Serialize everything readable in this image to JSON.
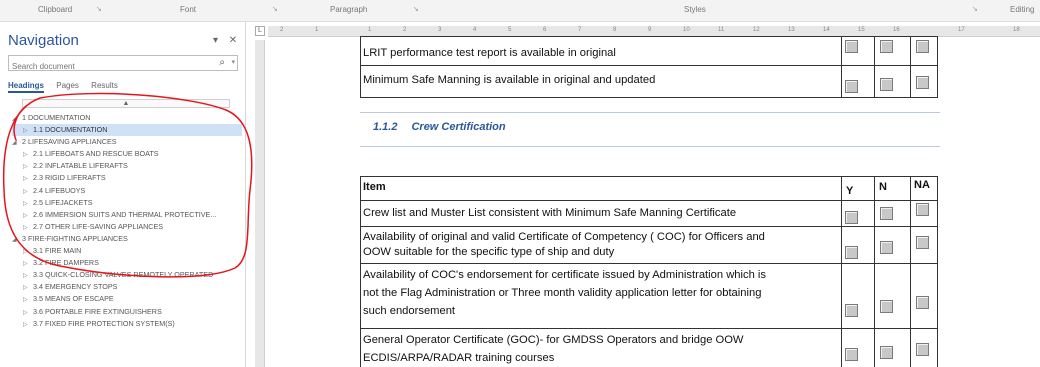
{
  "ribbon": {
    "groups": [
      "Clipboard",
      "Font",
      "Paragraph",
      "Styles",
      "Editing"
    ]
  },
  "nav": {
    "title": "Navigation",
    "title_controls": "▾ ✕",
    "search_placeholder": "Search document",
    "search_icon": "search-icon",
    "tabs": [
      "Headings",
      "Pages",
      "Results"
    ],
    "active_tab": "Headings",
    "collapse_glyph": "▲",
    "items": [
      {
        "level": 1,
        "label": "1 DOCUMENTATION",
        "expanded": true
      },
      {
        "level": 2,
        "label": "1.1 DOCUMENTATION",
        "selected": true
      },
      {
        "level": 1,
        "label": "2 LIFESAVING APPLIANCES",
        "expanded": true
      },
      {
        "level": 2,
        "label": "2.1 LIFEBOATS AND RESCUE BOATS"
      },
      {
        "level": 2,
        "label": "2.2 INFLATABLE LIFERAFTS"
      },
      {
        "level": 2,
        "label": "2.3 RIGID LIFERAFTS"
      },
      {
        "level": 2,
        "label": "2.4 LIFEBUOYS"
      },
      {
        "level": 2,
        "label": "2.5 LIFEJACKETS"
      },
      {
        "level": 2,
        "label": "2.6 IMMERSION SUITS AND THERMAL PROTECTIVE..."
      },
      {
        "level": 2,
        "label": "2.7 OTHER LIFE-SAVING APPLIANCES"
      },
      {
        "level": 1,
        "label": "3 FIRE-FIGHTING APPLIANCES",
        "expanded": true
      },
      {
        "level": 2,
        "label": "3.1 FIRE MAIN"
      },
      {
        "level": 2,
        "label": "3.2 FIRE DAMPERS"
      },
      {
        "level": 2,
        "label": "3.3 QUICK-CLOSING VALVES REMOTELY OPERATED"
      },
      {
        "level": 2,
        "label": "3.4 EMERGENCY STOPS"
      },
      {
        "level": 2,
        "label": "3.5 MEANS OF ESCAPE"
      },
      {
        "level": 2,
        "label": "3.6 PORTABLE FIRE EXTINGUISHERS"
      },
      {
        "level": 2,
        "label": "3.7 FIXED FIRE PROTECTION SYSTEM(S)"
      }
    ]
  },
  "ruler": {
    "corner_glyph": "L",
    "ticks": [
      "2",
      "1",
      "1",
      "2",
      "3",
      "4",
      "5",
      "6",
      "7",
      "8",
      "9",
      "10",
      "11",
      "12",
      "13",
      "14",
      "15",
      "16",
      "17",
      "18"
    ]
  },
  "document": {
    "top_rows": [
      "LRIT performance test report is available in original",
      "Minimum Safe Manning is available in original and updated"
    ],
    "section_number": "1.1.2",
    "section_title": "Crew Certification",
    "table_headers": {
      "item": "Item",
      "y": "Y",
      "n": "N",
      "na": "NA"
    },
    "table_rows": [
      [
        "Crew list and Muster List  consistent with Minimum Safe Manning Certificate"
      ],
      [
        "Availability of original and valid Certificate of Competency ( COC) for Officers and",
        "OOW suitable for the specific type of ship and duty"
      ],
      [
        "Availability of COC's endorsement  for certificate issued by Administration which is",
        "not the Flag Administration or Three month validity application letter for obtaining",
        "such endorsement"
      ],
      [
        "General Operator Certificate (GOC)- for GMDSS Operators and bridge OOW",
        "ECDIS/ARPA/RADAR training courses"
      ]
    ]
  },
  "colors": {
    "accent": "#2b579a",
    "annotation": "#e8141c",
    "selected_item": "#cfe1f7"
  }
}
